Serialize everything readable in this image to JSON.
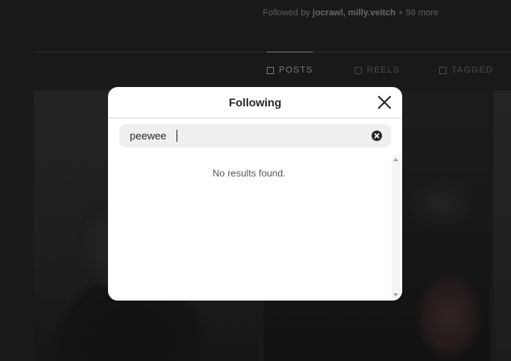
{
  "background": {
    "followed_by_prefix": "Followed by ",
    "followed_by_users": "jocrawl, milly.veitch",
    "followed_by_suffix": " + 98 more",
    "tabs": [
      {
        "label": "POSTS",
        "icon": "grid-icon",
        "active": true
      },
      {
        "label": "REELS",
        "icon": "reels-icon",
        "active": false
      },
      {
        "label": "TAGGED",
        "icon": "tagged-icon",
        "active": false
      }
    ]
  },
  "modal": {
    "title": "Following",
    "close_icon": "close-icon",
    "search": {
      "value": "peewee",
      "clear_icon": "clear-circle-icon"
    },
    "empty_message": "No results found."
  },
  "colors": {
    "modal_bg": "#ffffff",
    "search_bg": "#efefef",
    "text_primary": "#262626",
    "backdrop": "#1e1e1e"
  }
}
